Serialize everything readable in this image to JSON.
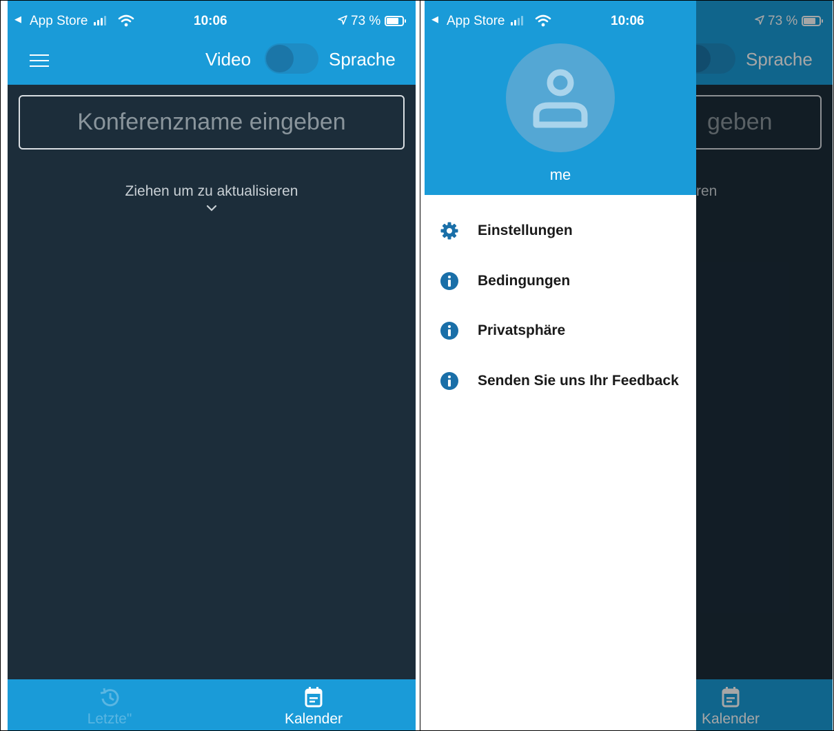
{
  "status": {
    "back_label": "◀",
    "carrier": "App Store",
    "time": "10:06",
    "battery_pct": "73 %"
  },
  "appbar": {
    "video_label": "Video",
    "sprache_label": "Sprache"
  },
  "main": {
    "conference_placeholder": "Konferenzname eingeben",
    "pull_hint": "Ziehen um zu aktualisieren",
    "right_partial_input": "geben",
    "right_partial_hint": "ren"
  },
  "bottom_nav": {
    "recent_label": "Letzte\"",
    "calendar_label": "Kalender"
  },
  "drawer": {
    "user_name": "me",
    "items": [
      {
        "label": "Einstellungen",
        "icon": "gear-icon"
      },
      {
        "label": "Bedingungen",
        "icon": "info-icon"
      },
      {
        "label": "Privatsphäre",
        "icon": "info-icon"
      },
      {
        "label": "Senden Sie uns Ihr Feedback",
        "icon": "info-icon"
      }
    ]
  },
  "colors": {
    "accent": "#1a9bd8",
    "background": "#1c2d3a",
    "drawer_bg": "#ffffff"
  }
}
